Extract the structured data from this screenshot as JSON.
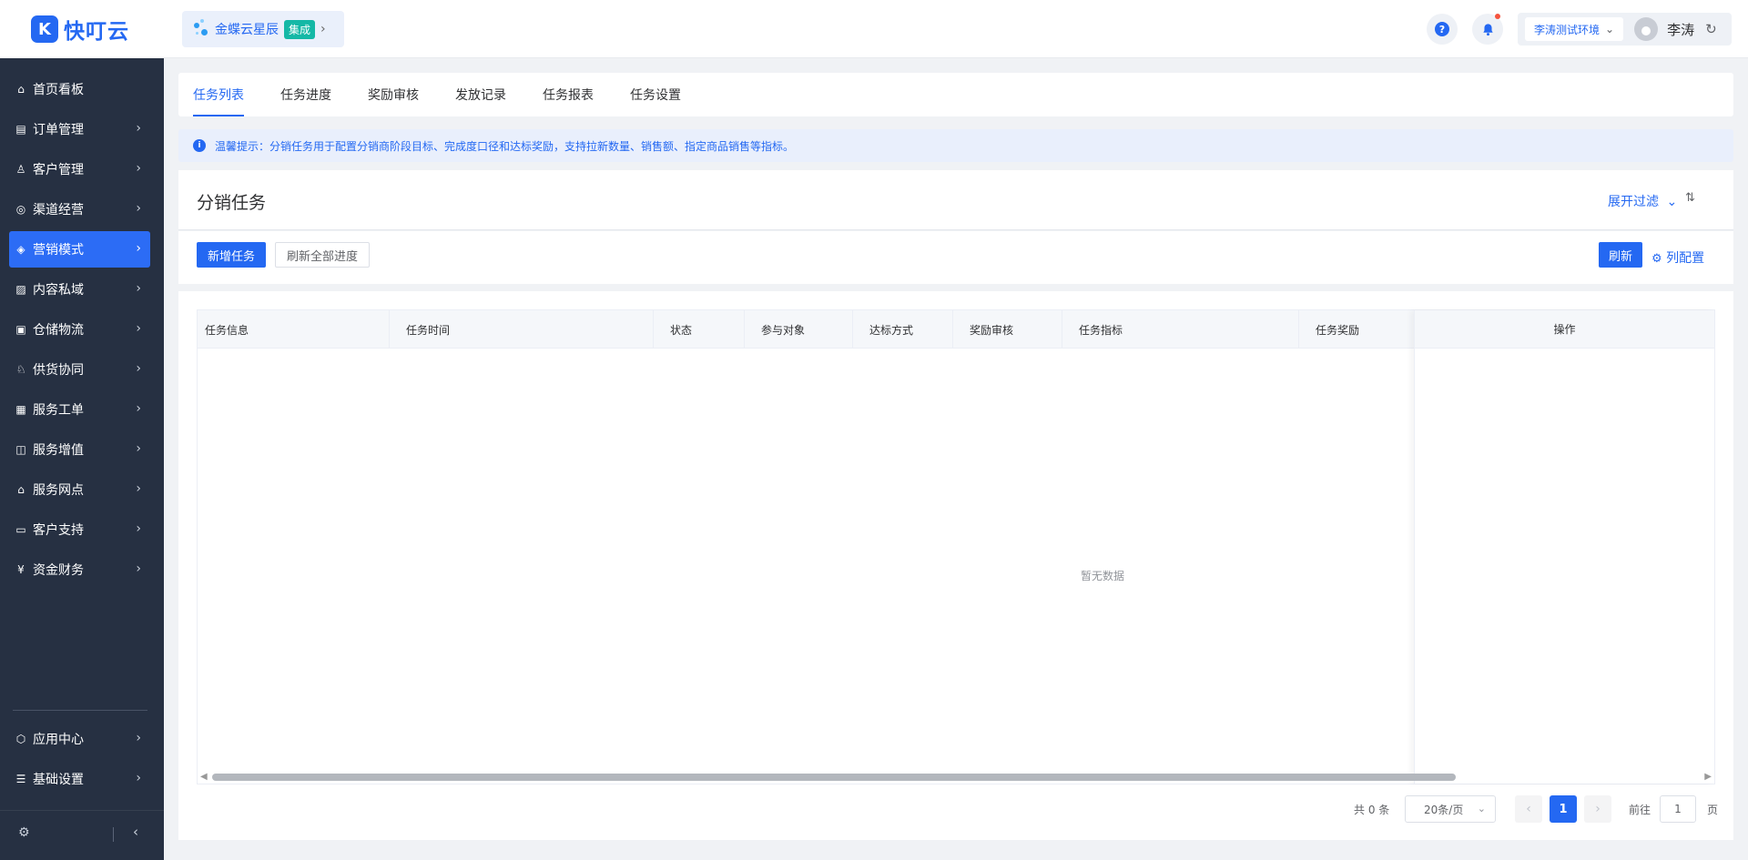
{
  "brand": {
    "logo_glyph": "K",
    "name": "快叮云"
  },
  "org": {
    "name": "金蝶云星辰",
    "tag": "集成"
  },
  "header": {
    "help_glyph": "?",
    "env": "李涛测试环境",
    "user": "李涛"
  },
  "sidebar": {
    "items": [
      {
        "label": "首页看板",
        "icon": "home-icon"
      },
      {
        "label": "订单管理",
        "icon": "order-icon"
      },
      {
        "label": "客户管理",
        "icon": "user-icon"
      },
      {
        "label": "渠道经营",
        "icon": "channel-icon"
      },
      {
        "label": "营销模式",
        "icon": "tag-icon"
      },
      {
        "label": "内容私域",
        "icon": "image-icon"
      },
      {
        "label": "仓储物流",
        "icon": "warehouse-icon"
      },
      {
        "label": "供货协同",
        "icon": "supply-icon"
      },
      {
        "label": "服务工单",
        "icon": "ticket-icon"
      },
      {
        "label": "服务增值",
        "icon": "bag-icon"
      },
      {
        "label": "服务网点",
        "icon": "store-icon"
      },
      {
        "label": "客户支持",
        "icon": "support-icon"
      },
      {
        "label": "资金财务",
        "icon": "yen-icon"
      }
    ],
    "bottom_items": [
      {
        "label": "应用中心",
        "icon": "cube-icon"
      },
      {
        "label": "基础设置",
        "icon": "settings-list-icon"
      }
    ],
    "active_index": 4
  },
  "tabs": [
    "任务列表",
    "任务进度",
    "奖励审核",
    "发放记录",
    "任务报表",
    "任务设置"
  ],
  "notice": "温馨提示：分销任务用于配置分销商阶段目标、完成度口径和达标奖励，支持拉新数量、销售额、指定商品销售等指标。",
  "page": {
    "title": "分销任务",
    "filter_label": "展开过滤"
  },
  "toolbar": {
    "add": "新增任务",
    "refresh_all": "刷新全部进度",
    "refresh": "刷新",
    "column_config": "列配置"
  },
  "table": {
    "columns": [
      "任务信息",
      "任务时间",
      "状态",
      "参与对象",
      "达标方式",
      "奖励审核",
      "任务指标",
      "任务奖励"
    ],
    "fixed_column": "操作",
    "empty_text": "暂无数据"
  },
  "pager": {
    "total": "共 0 条",
    "page_size": "20条/页",
    "current": "1",
    "goto_label": "前往",
    "goto_value": "1",
    "unit": "页"
  },
  "colors": {
    "accent": "#2468f2",
    "sidebar_bg": "#263042",
    "active_bg": "#2c6cf5"
  }
}
